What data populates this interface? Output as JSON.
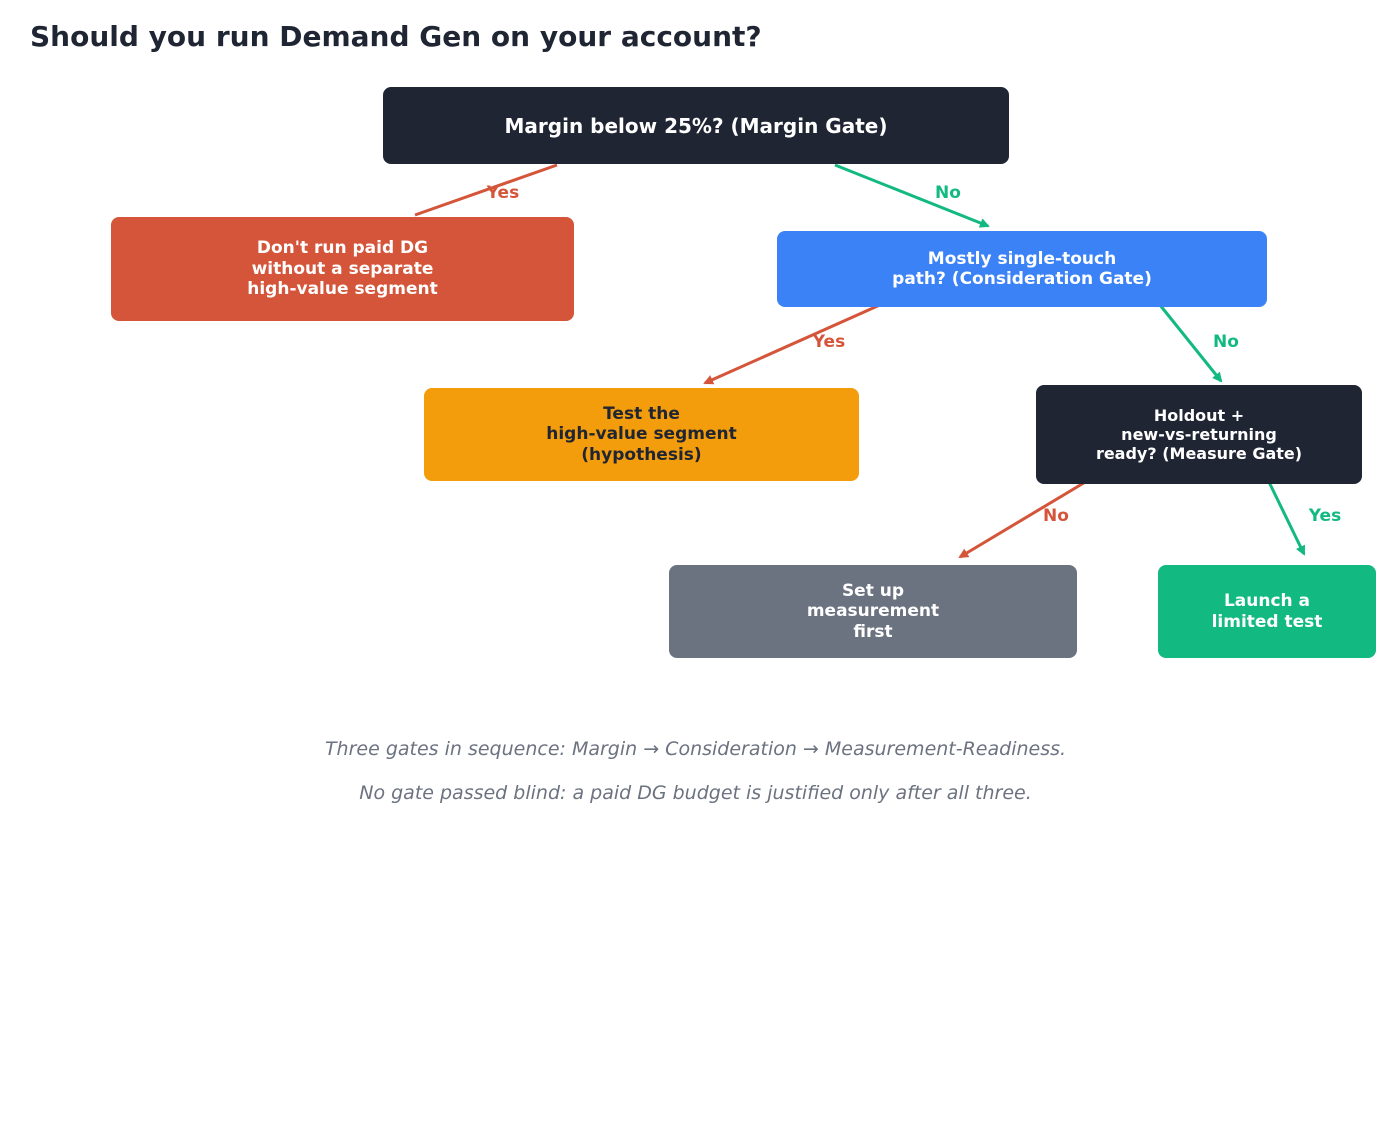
{
  "title": "Should you run Demand Gen on your account?",
  "colors": {
    "dark": "#1f2533",
    "red": "#d4553a",
    "blue": "#3b82f6",
    "amber": "#f39c0c",
    "gray": "#6b7280",
    "green": "#12b981",
    "yes_edge": "#d4553a",
    "no_edge": "#12b981"
  },
  "nodes": {
    "margin_gate": "Margin below 25%? (Margin Gate)",
    "dont_run": "Don't run paid DG\nwithout a separate\nhigh-value segment",
    "consideration_gate": "Mostly single-touch\npath? (Consideration Gate)",
    "test_segment": "Test the\nhigh-value segment\n(hypothesis)",
    "measure_gate": "Holdout +\nnew-vs-returning\nready? (Measure Gate)",
    "setup_measurement": "Set up\nmeasurement\nfirst",
    "launch_test": "Launch a\nlimited test"
  },
  "edges": {
    "margin_yes": "Yes",
    "margin_no": "No",
    "consideration_yes": "Yes",
    "consideration_no": "No",
    "measure_no": "No",
    "measure_yes": "Yes"
  },
  "captions": {
    "line1": "Three gates in sequence: Margin → Consideration → Measurement-Readiness.",
    "line2": "No gate passed blind: a paid DG budget is justified only after all three."
  }
}
